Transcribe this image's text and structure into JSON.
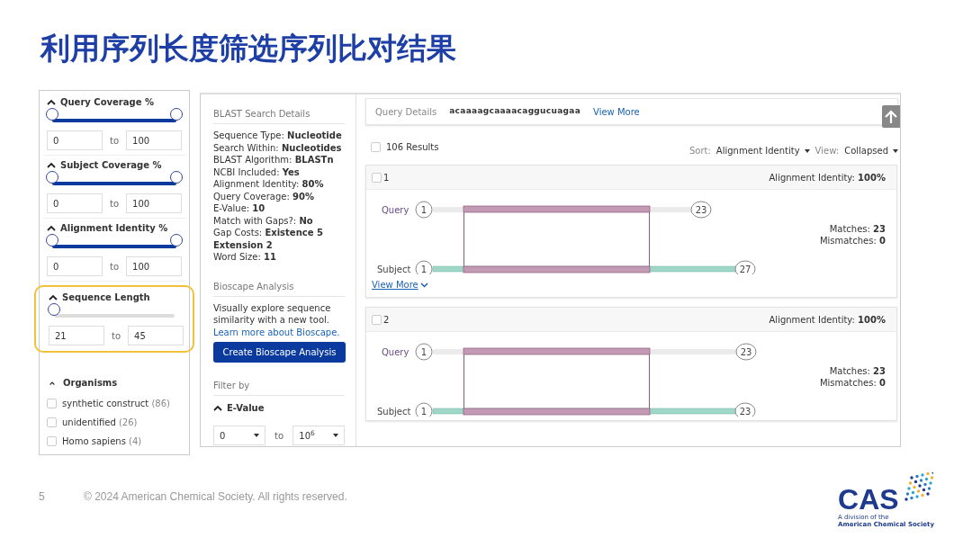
{
  "slide_title": "利用序列长度筛选序列比对结果",
  "range_filters": [
    {
      "title": "Query Coverage %",
      "level": 1,
      "from": "0",
      "to_label": "to",
      "to": "100",
      "highlighted": false
    },
    {
      "title": "Subject Coverage %",
      "level": 1,
      "from": "0",
      "to_label": "to",
      "to": "100",
      "highlighted": false
    },
    {
      "title": "Alignment Identity %",
      "level": 1,
      "from": "0",
      "to_label": "to",
      "to": "100",
      "highlighted": false
    },
    {
      "title": "Sequence Length",
      "level": 0,
      "from": "21",
      "to_label": "to",
      "to": "45",
      "highlighted": true
    }
  ],
  "organisms": {
    "title": "Organisms",
    "items": [
      {
        "label": "synthetic construct",
        "count": "(86)",
        "checked": false
      },
      {
        "label": "unidentified",
        "count": "(26)",
        "checked": false
      },
      {
        "label": "Homo sapiens",
        "count": "(4)",
        "checked": false
      }
    ]
  },
  "blast_details": {
    "heading": "BLAST Search Details",
    "rows": [
      {
        "label": "Sequence Type:",
        "value": "Nucleotide"
      },
      {
        "label": "Search Within:",
        "value": "Nucleotides"
      },
      {
        "label": "BLAST Algorithm:",
        "value": "BLASTn"
      },
      {
        "label": "NCBI Included:",
        "value": "Yes"
      },
      {
        "label": "Alignment Identity:",
        "value": "80%"
      },
      {
        "label": "Query Coverage:",
        "value": "90%"
      },
      {
        "label": "E-Value:",
        "value": "10"
      },
      {
        "label": "Match with Gaps?:",
        "value": "No"
      },
      {
        "label": "Gap Costs:",
        "value": "Existence 5 Extension 2"
      },
      {
        "label": "Word Size:",
        "value": "11"
      }
    ]
  },
  "bioscape": {
    "heading": "Bioscape Analysis",
    "text": "Visually explore sequence similarity with a new tool.",
    "link": "Learn more about Bioscape.",
    "button": "Create Bioscape Analysis"
  },
  "filter_by": {
    "heading": "Filter by",
    "evalue_title": "E-Value",
    "from": "0",
    "to_label": "to",
    "to": "10$^{6}$"
  },
  "query_details": {
    "label": "Query Details",
    "sequence": "acaaaagcaaaacaggucuagaa",
    "link": "View More"
  },
  "results_count": "106 Results",
  "select_all_checked": false,
  "sort": {
    "label": "Sort:",
    "value": "Alignment Identity"
  },
  "view": {
    "label": "View:",
    "value": "Collapsed"
  },
  "results": [
    {
      "number": "1",
      "checked": false,
      "identity_label": "Alignment Identity:",
      "identity": "100%",
      "query_label": "Query",
      "query_start": "1",
      "query_end": "23",
      "subject_label": "Subject",
      "subject_start": "1",
      "subject_end": "27",
      "kind": "partial",
      "matches_label": "Matches:",
      "matches": "23",
      "mismatches_label": "Mismatches:",
      "mismatches": "0",
      "view_more": "View More"
    },
    {
      "number": "2",
      "checked": false,
      "identity_label": "Alignment Identity:",
      "identity": "100%",
      "query_label": "Query",
      "query_start": "1",
      "query_end": "23",
      "subject_label": "Subject",
      "subject_start": "1",
      "subject_end": "23",
      "kind": "full",
      "matches_label": "Matches:",
      "matches": "23",
      "mismatches_label": "Mismatches:",
      "mismatches": "0"
    }
  ],
  "footer": {
    "page_number": "5",
    "copyright": "© 2024 American Chemical Society. All rights reserved.",
    "logo_text": "CAS",
    "logo_sub1": "A division of the",
    "logo_sub2": "American Chemical Society"
  }
}
